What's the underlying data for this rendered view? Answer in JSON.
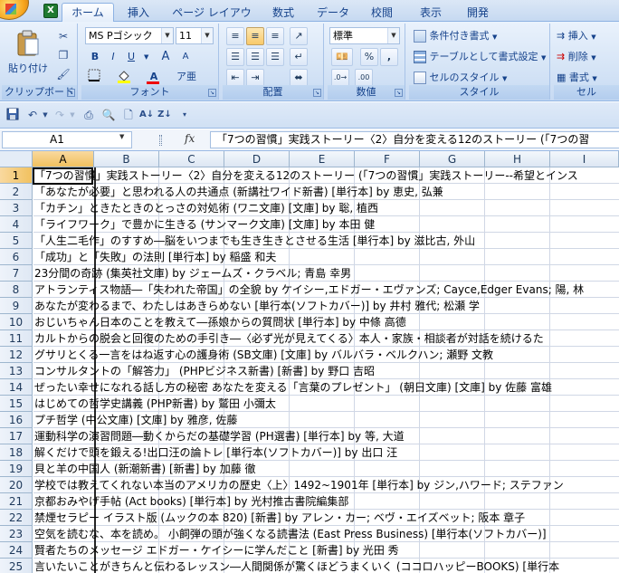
{
  "tabs": [
    "ホーム",
    "挿入",
    "ページ レイアウト",
    "数式",
    "データ",
    "校閲",
    "表示",
    "開発"
  ],
  "active_tab": "ホーム",
  "ribbon": {
    "clipboard": {
      "paste_label": "貼り付け",
      "group_label": "クリップボード"
    },
    "font": {
      "font_name": "MS Pゴシック",
      "font_size": "11",
      "group_label": "フォント",
      "bold": "B",
      "italic": "I",
      "underline": "U",
      "grow": "A",
      "shrink": "A",
      "font_color": "A"
    },
    "alignment": {
      "group_label": "配置"
    },
    "number": {
      "format": "標準",
      "percent": "%",
      "comma": ",",
      "group_label": "数値"
    },
    "style": {
      "conditional": "条件付き書式",
      "table": "テーブルとして書式設定",
      "cell_style": "セルのスタイル",
      "group_label": "スタイル"
    },
    "cells": {
      "insert": "挿入",
      "delete": "削除",
      "format": "書式",
      "group_label": "セル"
    }
  },
  "formula_bar": {
    "name_box": "A1",
    "fx": "fx",
    "content": "「7つの習慣」実践ストーリー〈2〉自分を変える12のストーリー (「7つの習"
  },
  "columns": [
    "A",
    "B",
    "C",
    "D",
    "E",
    "F",
    "G",
    "H",
    "I"
  ],
  "selected_cell": "A1",
  "rows": [
    {
      "n": "1",
      "text": "「7つの習慣」実践ストーリー〈2〉自分を変える12のストーリー (「7つの習慣」実践ストーリー--希望とインス"
    },
    {
      "n": "2",
      "text": "「あなたが必要」と思われる人の共通点 (新講社ワイド新書) [単行本] by 恵史, 弘兼"
    },
    {
      "n": "3",
      "text": "「カチン」ときたときのとっさの対処術 (ワニ文庫) [文庫] by 聡, 植西"
    },
    {
      "n": "4",
      "text": "「ライフワーク」で豊かに生きる (サンマーク文庫) [文庫] by 本田 健"
    },
    {
      "n": "5",
      "text": "「人生二毛作」のすすめ―脳をいつまでも生き生きとさせる生活 [単行本] by 滋比古, 外山"
    },
    {
      "n": "6",
      "text": "「成功」と「失敗」の法則 [単行本] by 稲盛 和夫"
    },
    {
      "n": "7",
      "text": "23分間の奇跡 (集英社文庫) by ジェームズ・クラベル; 青島 幸男"
    },
    {
      "n": "8",
      "text": "アトランティス物語―「失われた帝国」の全貌 by ケイシー,エドガー・エヴァンズ; Cayce,Edger Evans; 陽, 林"
    },
    {
      "n": "9",
      "text": "あなたが変わるまで、わたしはあきらめない [単行本(ソフトカバー)] by 井村 雅代; 松瀬 学"
    },
    {
      "n": "10",
      "text": "おじいちゃん日本のことを教えて―孫娘からの質問状 [単行本] by 中條 高德"
    },
    {
      "n": "11",
      "text": "カルトからの脱会と回復のための手引き―〈必ず光が見えてくる〉本人・家族・相談者が対話を続けるた"
    },
    {
      "n": "12",
      "text": "グサリとくる一言をはね返す心の護身術 (SB文庫) [文庫] by バルバラ・ベルクハン; 瀬野 文教"
    },
    {
      "n": "13",
      "text": "コンサルタントの「解答力」 (PHPビジネス新書) [新書] by 野口 吉昭"
    },
    {
      "n": "14",
      "text": "ぜったい幸せになれる話し方の秘密 あなたを変える「言葉のプレゼント」 (朝日文庫) [文庫] by 佐藤 富雄"
    },
    {
      "n": "15",
      "text": "はじめての哲学史講義 (PHP新書) by 鷲田 小彌太"
    },
    {
      "n": "16",
      "text": "プチ哲学 (中公文庫) [文庫] by 雅彦, 佐藤"
    },
    {
      "n": "17",
      "text": "運動科学の演習問題―動くからだの基礎学習 (PH選書) [単行本] by 等, 大道"
    },
    {
      "n": "18",
      "text": "解くだけで頭を鍛える!出口汪の論トレ [単行本(ソフトカバー)] by 出口 汪"
    },
    {
      "n": "19",
      "text": "貝と羊の中国人 (新潮新書) [新書] by 加藤 徹"
    },
    {
      "n": "20",
      "text": "学校では教えてくれない本当のアメリカの歴史〈上〉1492~1901年 [単行本] by ジン,ハワード; ステファン"
    },
    {
      "n": "21",
      "text": "京都おみやげ手帖 (Act books) [単行本] by 光村推古書院編集部"
    },
    {
      "n": "22",
      "text": "禁煙セラピー イラスト版 (ムックの本 820) [新書] by アレン・カー; ベヴ・エイズベット; 阪本 章子"
    },
    {
      "n": "23",
      "text": "空気を読むな、本を読め。 小飼弾の頭が強くなる読書法 (East Press Business) [単行本(ソフトカバー)]"
    },
    {
      "n": "24",
      "text": "賢者たちのメッセージ エドガー・ケイシーに学んだこと [新書] by 光田 秀"
    },
    {
      "n": "25",
      "text": "言いたいことがきちんと伝わるレッスン―人間関係が驚くほどうまくいく (ココロハッピーBOOKS) [単行本"
    }
  ],
  "colors": {
    "accent": "#15428b",
    "selection": "#f1c15f",
    "grid": "#d0d7e5"
  }
}
